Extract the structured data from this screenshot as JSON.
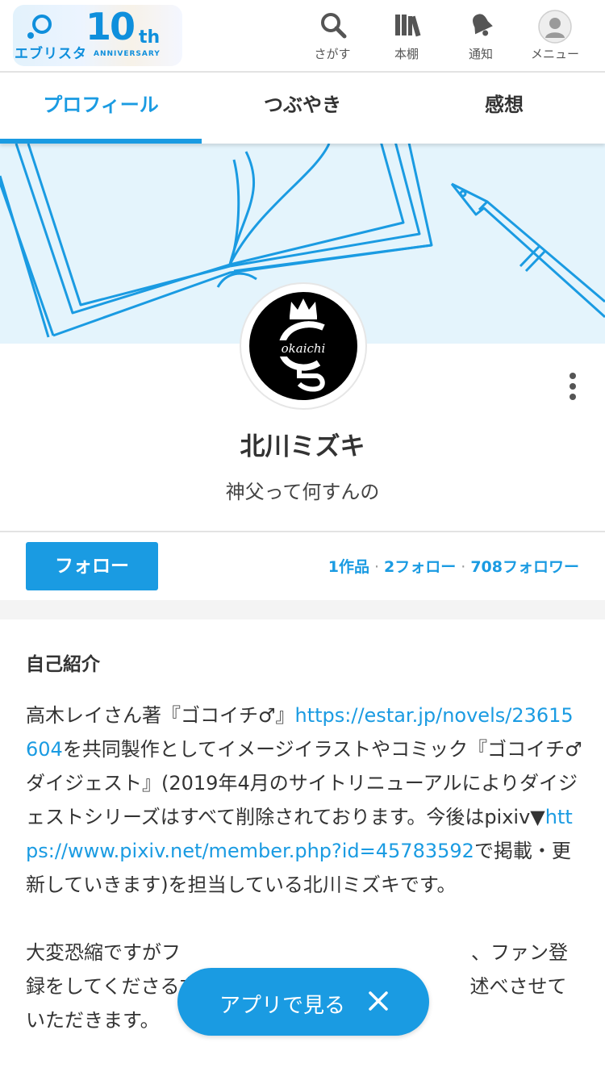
{
  "header": {
    "logo_name": "エブリスタ",
    "logo_ten": "10",
    "logo_th": "th",
    "logo_anniversary": "ANNIVERSARY",
    "nav": [
      {
        "label": "さがす",
        "icon": "search-icon"
      },
      {
        "label": "本棚",
        "icon": "bookshelf-icon"
      },
      {
        "label": "通知",
        "icon": "bell-icon"
      },
      {
        "label": "メニュー",
        "icon": "user-avatar-icon"
      }
    ]
  },
  "tabs": [
    {
      "label": "プロフィール",
      "active": true
    },
    {
      "label": "つぶやき",
      "active": false
    },
    {
      "label": "感想",
      "active": false
    }
  ],
  "profile": {
    "avatar_text": "okaichi",
    "name": "北川ミズキ",
    "tagline": "神父って何すんの",
    "follow_label": "フォロー",
    "works": "1作品",
    "following": "2フォロー",
    "followers": "708フォロワー"
  },
  "bio": {
    "title": "自己紹介",
    "p1_a": "高木レイさん著『ゴコイチ♂』",
    "p1_link1": "https://estar.jp/novels/23615604",
    "p1_b": "を共同製作としてイメージイラストやコミック『ゴコイチ♂ダイジェスト』(2019年4月のサイトリニューアルによりダイジェストシリーズはすべて削除されております。今後はpixiv▼",
    "p1_link2": "https://www.pixiv.net/member.php?id=45783592",
    "p1_c": "で掲載・更新していきます)を担当している北川ミズキです。",
    "p2": "大変恐縮ですがフ　　　　　　　　　　　　　　　、ファン登録をしてくださる方に　　　　　　　　　　　　　述べさせていただきます。"
  },
  "app_banner": {
    "label": "アプリで見る"
  },
  "colors": {
    "accent": "#1a9be2",
    "cover_bg": "#e4f4fc"
  }
}
